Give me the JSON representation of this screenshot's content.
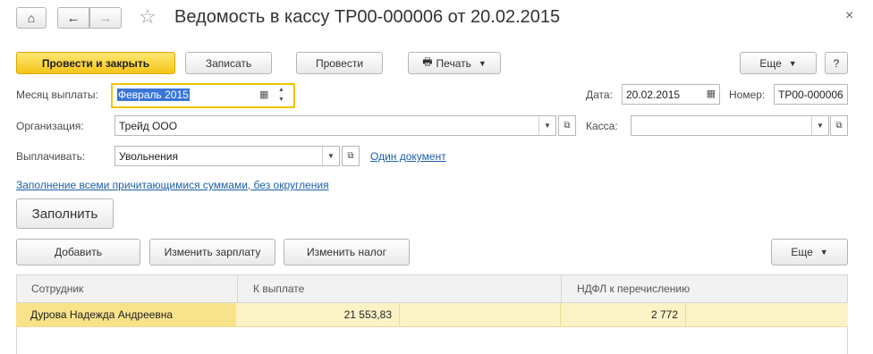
{
  "header": {
    "title": "Ведомость в кассу ТР00-000006 от 20.02.2015",
    "close": "×"
  },
  "toolbar": {
    "post_close": "Провести и закрыть",
    "save": "Записать",
    "post": "Провести",
    "print": "Печать",
    "more": "Еще",
    "help": "?"
  },
  "form": {
    "month_label": "Месяц выплаты:",
    "month_value": "Февраль 2015",
    "date_label": "Дата:",
    "date_value": "20.02.2015",
    "number_label": "Номер:",
    "number_value": "ТР00-000006",
    "org_label": "Организация:",
    "org_value": "Трейд ООО",
    "cashbox_label": "Касса:",
    "cashbox_value": "",
    "pay_label": "Выплачивать:",
    "pay_value": "Увольнения",
    "one_doc_link": "Один документ",
    "fill_mode_link": "Заполнение всеми причитающимися суммами, без округления",
    "fill_button": "Заполнить"
  },
  "table_toolbar": {
    "add": "Добавить",
    "change_salary": "Изменить зарплату",
    "change_tax": "Изменить налог",
    "more": "Еще"
  },
  "table": {
    "columns": [
      "Сотрудник",
      "К выплате",
      "НДФЛ к перечислению"
    ],
    "rows": [
      {
        "employee": "Дурова Надежда Андреевна",
        "payment": "21 553,83",
        "ndfl": "2 772"
      }
    ]
  },
  "colors": {
    "accent": "#f5c518",
    "link": "#1c5fa8",
    "selected_row": "#fbf3c6"
  }
}
